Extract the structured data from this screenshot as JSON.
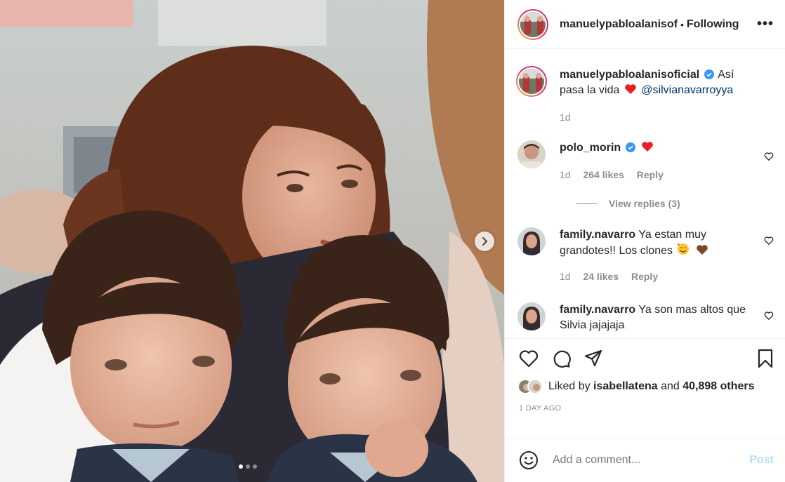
{
  "post": {
    "author": "manuelypabloalanisofi",
    "separator": "•",
    "follow_status": "Following",
    "more_label": "•••",
    "carousel": {
      "slides": 3,
      "active_index": 0
    }
  },
  "caption": {
    "username": "manuelypabloalanisoficial",
    "verified": true,
    "text": "Así pasa la vida",
    "mention": "@silvianavarroyya",
    "time": "1d"
  },
  "comments": [
    {
      "username": "polo_morin",
      "verified": true,
      "text": "",
      "time": "1d",
      "likes": "264 likes",
      "reply_label": "Reply",
      "view_replies": "View replies (3)"
    },
    {
      "username": "family.navarro",
      "verified": false,
      "text": "Ya estan muy grandotes!! Los clones",
      "time": "1d",
      "likes": "24 likes",
      "reply_label": "Reply"
    },
    {
      "username": "family.navarro",
      "verified": false,
      "text": "Ya son mas altos que Silvia jajajaja"
    }
  ],
  "likes": {
    "prefix": "Liked by",
    "user": "isabellatena",
    "middle": "and",
    "others": "40,898 others"
  },
  "timestamp": "1 DAY AGO",
  "add_comment": {
    "placeholder": "Add a comment...",
    "post_label": "Post"
  },
  "colors": {
    "verified": "#3897f0",
    "heart": "#ed4956",
    "mention": "#00376b",
    "post_disabled": "#b2dffc"
  },
  "icons": [
    "heart-icon",
    "comment-icon",
    "share-icon",
    "bookmark-icon",
    "emoji-icon",
    "chevron-right-icon",
    "verified-badge-icon"
  ]
}
